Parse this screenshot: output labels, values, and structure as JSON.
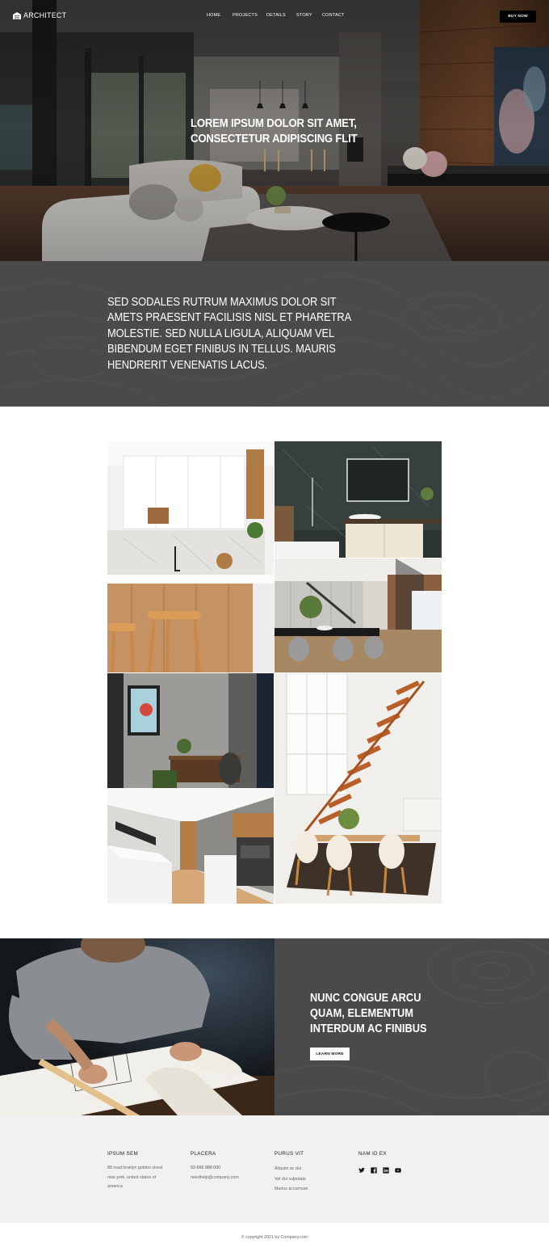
{
  "brand": {
    "name": "ARCHITECT",
    "logo_icon": "building-icon"
  },
  "nav": {
    "items": [
      "HOME",
      "PROJECTS",
      "DETAILS",
      "STORY",
      "CONTACT"
    ],
    "cta_label": "BUY NOW"
  },
  "hero": {
    "title": "LOREM IPSUM DOLOR SIT AMET, CONSECTETUR ADIPISCING FLIT"
  },
  "intro": {
    "text": "SED SODALES RUTRUM MAXIMUS DOLOR SIT AMETS PRAESENT FACILISIS NISL ET PHARETRA MOLESTIE. SED NULLA LIGULA, ALIQUAM VEL BIBENDUM EGET FINIBUS IN TELLUS. MAURIS HENDRERIT VENENATIS LACUS."
  },
  "gallery": {
    "images": [
      "kitchen-bar-photo",
      "bathroom-photo",
      "dining-staircase-photo",
      "office-desk-photo",
      "wooden-staircase-photo",
      "galley-kitchen-photo"
    ]
  },
  "cta": {
    "title": "NUNC CONGUE ARCU QUAM, ELEMENTUM INTERDUM AC FINIBUS",
    "button_label": "LEARN MORE"
  },
  "footer": {
    "col1": {
      "heading": "IPSUM SEM",
      "lines": [
        "88 road broklyn golden street",
        "new york, united states of",
        "america"
      ]
    },
    "col2": {
      "heading": "PLACERA",
      "lines": [
        "92-666 888 000",
        "needhelp@company.com"
      ]
    },
    "col3": {
      "heading": "PURUS VIT",
      "lines": [
        "Aliquim ac dui",
        "Vel dui vulputate",
        "Marius accumsan"
      ]
    },
    "col4": {
      "heading": "NAM ID EX",
      "social_icons": [
        "twitter-icon",
        "facebook-icon",
        "linkedin-icon",
        "youtube-icon"
      ]
    },
    "copyright": "© copyright 2021 by Company.com"
  },
  "colors": {
    "dark_panel": "#4a4a4a",
    "footer_bg": "#f1f1f1",
    "button_dark": "#000000"
  }
}
